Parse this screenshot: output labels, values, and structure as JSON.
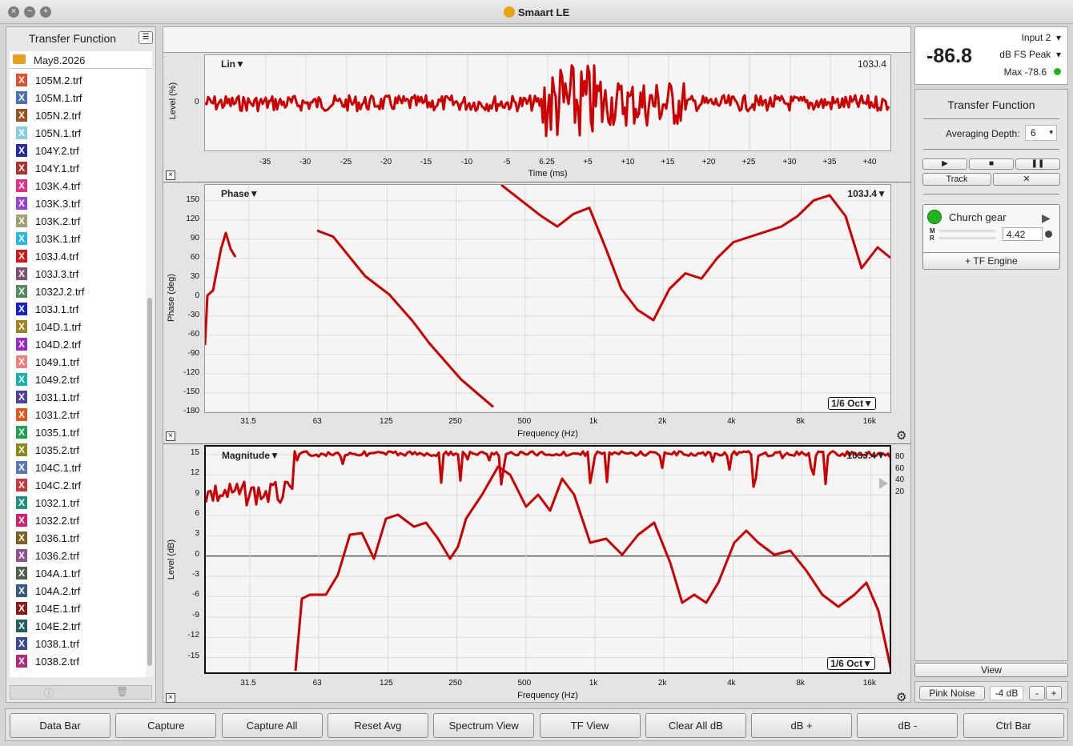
{
  "app": {
    "title": "Smaart LE"
  },
  "sidebar": {
    "title": "Transfer Function",
    "folder": "May8.2026",
    "files": [
      {
        "label": "105M.2.trf",
        "color": "#e05030"
      },
      {
        "label": "105M.1.trf",
        "color": "#4a70b0"
      },
      {
        "label": "105N.2.trf",
        "color": "#9a5020"
      },
      {
        "label": "105N.1.trf",
        "color": "#88cce0"
      },
      {
        "label": "104Y.2.trf",
        "color": "#2a2aa0"
      },
      {
        "label": "104Y.1.trf",
        "color": "#b03030"
      },
      {
        "label": "103K.4.trf",
        "color": "#e0308a"
      },
      {
        "label": "103K.3.trf",
        "color": "#9a40d0"
      },
      {
        "label": "103K.2.trf",
        "color": "#a0a070"
      },
      {
        "label": "103K.1.trf",
        "color": "#28b8e0"
      },
      {
        "label": "103J.4.trf",
        "color": "#d01818"
      },
      {
        "label": "103J.3.trf",
        "color": "#805070"
      },
      {
        "label": "1032J.2.trf",
        "color": "#508a60"
      },
      {
        "label": "103J.1.trf",
        "color": "#1a20c8"
      },
      {
        "label": "104D.1.trf",
        "color": "#a08020"
      },
      {
        "label": "104D.2.trf",
        "color": "#9a28c8"
      },
      {
        "label": "1049.1.trf",
        "color": "#f08080"
      },
      {
        "label": "1049.2.trf",
        "color": "#18b0b0"
      },
      {
        "label": "1031.1.trf",
        "color": "#5040a0"
      },
      {
        "label": "1031.2.trf",
        "color": "#e05818"
      },
      {
        "label": "1035.1.trf",
        "color": "#20a050"
      },
      {
        "label": "1035.2.trf",
        "color": "#8a8a18"
      },
      {
        "label": "104C.1.trf",
        "color": "#5878b0"
      },
      {
        "label": "104C.2.trf",
        "color": "#c83838"
      },
      {
        "label": "1032.1.trf",
        "color": "#209080"
      },
      {
        "label": "1032.2.trf",
        "color": "#d02070"
      },
      {
        "label": "1036.1.trf",
        "color": "#806020"
      },
      {
        "label": "1036.2.trf",
        "color": "#8a5090"
      },
      {
        "label": "104A.1.trf",
        "color": "#506050"
      },
      {
        "label": "104A.2.trf",
        "color": "#3a5880"
      },
      {
        "label": "104E.1.trf",
        "color": "#8a1818"
      },
      {
        "label": "104E.2.trf",
        "color": "#20605a"
      },
      {
        "label": "1038.1.trf",
        "color": "#3a4a98"
      },
      {
        "label": "1038.2.trf",
        "color": "#b02878"
      }
    ]
  },
  "impulse": {
    "mode": "Lin",
    "trace": "103J.4",
    "ylabel": "Level (%)",
    "xlabel": "Time (ms)",
    "ytick": "0",
    "xticks": [
      "-35",
      "-30",
      "-25",
      "-20",
      "-15",
      "-10",
      "-5",
      "6.25",
      "+5",
      "+10",
      "+15",
      "+20",
      "+25",
      "+30",
      "+35",
      "+40"
    ]
  },
  "phase": {
    "mode": "Phase",
    "trace": "103J.4",
    "ylabel": "Phase (deg)",
    "xlabel": "Frequency (Hz)",
    "smoothing": "1/6 Oct",
    "yticks": [
      "150",
      "120",
      "90",
      "60",
      "30",
      "0",
      "-30",
      "-60",
      "-90",
      "-120",
      "-150",
      "-180"
    ],
    "xticks": [
      "31.5",
      "63",
      "125",
      "250",
      "500",
      "1k",
      "2k",
      "4k",
      "8k",
      "16k"
    ]
  },
  "magnitude": {
    "mode": "Magnitude",
    "trace": "103J.4",
    "ylabel": "Level (dB)",
    "xlabel": "Frequency (Hz)",
    "smoothing": "1/6 Oct",
    "yticks": [
      "15",
      "12",
      "9",
      "6",
      "3",
      "0",
      "-3",
      "-6",
      "-9",
      "-12",
      "-15"
    ],
    "xticks": [
      "31.5",
      "63",
      "125",
      "250",
      "500",
      "1k",
      "2k",
      "4k",
      "8k",
      "16k"
    ],
    "coherence_ticks": [
      "80",
      "60",
      "40",
      "20"
    ]
  },
  "meter": {
    "input": "Input 2",
    "value": "-86.8",
    "unit": "dB FS Peak",
    "max": "Max -78.6"
  },
  "tf": {
    "title": "Transfer Function",
    "averaging_label": "Averaging Depth:",
    "averaging_value": "6",
    "track_label": "Track",
    "engine_name": "Church gear",
    "delay_value": "4.42",
    "m_label": "M",
    "r_label": "R",
    "add_engine": "+ TF Engine"
  },
  "right_bottom": {
    "view_label": "View",
    "pink_noise": "Pink Noise",
    "level": "-4 dB",
    "minus": "-",
    "plus": "+"
  },
  "toolbar": [
    "Data Bar",
    "Capture",
    "Capture All",
    "Reset Avg",
    "Spectrum View",
    "TF View",
    "Clear All dB",
    "dB +",
    "dB -",
    "Ctrl Bar"
  ],
  "colors": {
    "trace": "#cc0000",
    "accent": "#1fb51f"
  }
}
